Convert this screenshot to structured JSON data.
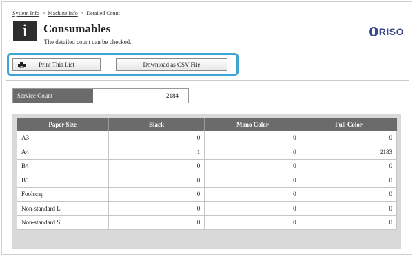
{
  "breadcrumb": {
    "item1": "System Info",
    "sep": ">",
    "item2": "Machine Info",
    "item3": "Detailed Count"
  },
  "header": {
    "icon_glyph": "i",
    "title": "Consumables",
    "subtitle": "The detailed count can be checked."
  },
  "logo": {
    "text": "RISO",
    "color": "#3a4a8c"
  },
  "toolbar": {
    "print_label": "Print This List",
    "csv_label": "Download as CSV File",
    "highlight_color": "#3ea4d6"
  },
  "service_count": {
    "label": "Service Count",
    "value": "2184"
  },
  "table": {
    "headers": [
      "Paper Size",
      "Black",
      "Mono Color",
      "Full Color"
    ],
    "rows": [
      [
        "A3",
        "0",
        "0",
        "0"
      ],
      [
        "A4",
        "1",
        "0",
        "2183"
      ],
      [
        "B4",
        "0",
        "0",
        "0"
      ],
      [
        "B5",
        "0",
        "0",
        "0"
      ],
      [
        "Foolscap",
        "0",
        "0",
        "0"
      ],
      [
        "Non-standard L",
        "0",
        "0",
        "0"
      ],
      [
        "Non-standard S",
        "0",
        "0",
        "0"
      ]
    ]
  }
}
